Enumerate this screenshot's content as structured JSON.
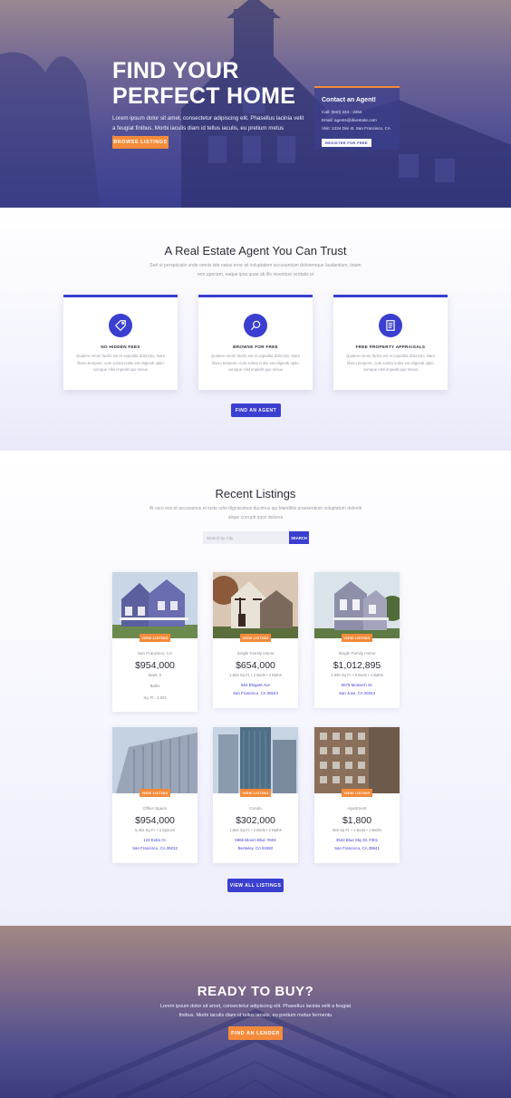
{
  "hero": {
    "title_line1": "FIND YOUR",
    "title_line2": "PERFECT HOME",
    "text": "Lorem ipsum dolor sit amet, consectetur adipiscing elit. Phasellus lacinia velit a feugiat finibus. Morbi iaculis diam id tellus iaculis, eu pretium metus fermentu",
    "button": "BROWSE LISTINGS"
  },
  "agent_card": {
    "title": "Contact an Agent!",
    "call": "Call: (940) 234 - 3354",
    "email": "Email: agents@divestate.com",
    "visit": "Visit: 1234 Divi st. San Francisco, CA",
    "button": "REGISTER FOR FREE"
  },
  "trust": {
    "title": "A Real Estate Agent You Can Trust",
    "subtitle": "Sed ut perspiciatis unde omnis iste natus error sit voluptatem accusantium doloremque laudantium, totam rem aperiam, eaque ipsa quae ab illo inventore veritatis et",
    "features": [
      {
        "title": "NO HIDDEN FEES",
        "text": "Quidem rerum facilis est et expedita distinctio. Nam libero tempore, cum soluta nobis est eligendi optio cumque nihil impedit quo minus",
        "icon": "tag-icon"
      },
      {
        "title": "BROWSE FOR FREE",
        "text": "Quidem rerum facilis est et expedita distinctio. Nam libero tempore, cum soluta nobis est eligendi optio cumque nihil impedit quo minus",
        "icon": "search-icon"
      },
      {
        "title": "FREE PROPERTY APPRAISALS",
        "text": "Quidem rerum facilis est et expedita distinctio. Nam libero tempore, cum soluta nobis est eligendi optio cumque nihil impedit quo minus",
        "icon": "document-icon"
      }
    ],
    "button": "FIND AN AGENT"
  },
  "listings": {
    "title": "Recent Listings",
    "subtitle": "At vero eos et accusamus et iusto odio dignissimos ducimus qui blanditiis praesentium voluptatum deleniti atque corrupti quos dolores",
    "search_placeholder": "Search by City",
    "search_button": "SEARCH",
    "view_label": "VIEW LISTING",
    "cards": [
      {
        "type": "San Francisco, CA",
        "price": "$954,000",
        "meta1": "Beds: 5",
        "meta2": "Baths",
        "meta3": "Sq. Ft.: 2,503"
      },
      {
        "type": "Single Family Home",
        "price": "$654,000",
        "meta1": "1,654 Sq Ft.  •  2 Beds  •  2 Baths",
        "addr1": "564 Elegant Ave",
        "addr2": "San Francisco, CA 39244"
      },
      {
        "type": "Single Family Home",
        "price": "$1,012,895",
        "meta1": "2,930 Sq Ft.  •  5 Beds  •  4 Baths",
        "addr1": "6578 Monarch St.",
        "addr2": "San Jose, CA 28344"
      },
      {
        "type": "Office Space",
        "price": "$954,000",
        "meta1": "5,452 Sq Ft.  •  3 Spaces",
        "addr1": "123 Extra Ct.",
        "addr2": "San Francisco, CA 39232"
      },
      {
        "type": "Condo",
        "price": "$302,000",
        "meta1": "1,654 Sq Ft.  •  2 Beds  •  2 Baths",
        "addr1": "6965 Bloom Blvd. #604",
        "addr2": "Berkeley, CA 91882"
      },
      {
        "type": "Apartment",
        "price": "$1,800",
        "meta1": "650 Sq Ft.  •  1 Beds  •  1 Baths",
        "addr1": "3542 Blue Sky Dr. #301",
        "addr2": "San Francisco, CA 39841"
      }
    ],
    "button": "VIEW ALL LISTINGS"
  },
  "cta": {
    "title": "READY TO BUY?",
    "text": "Lorem ipsum dolor sit amet, consectetur adipiscing elit. Phasellus lacinia velit a feugiat finibus. Morbi iaculis diam id tellus iaculis, eu pretium metus fermentu",
    "button": "FIND AN LENDER"
  },
  "colors": {
    "accent": "#3b3fd0",
    "orange": "#f48b3a"
  }
}
